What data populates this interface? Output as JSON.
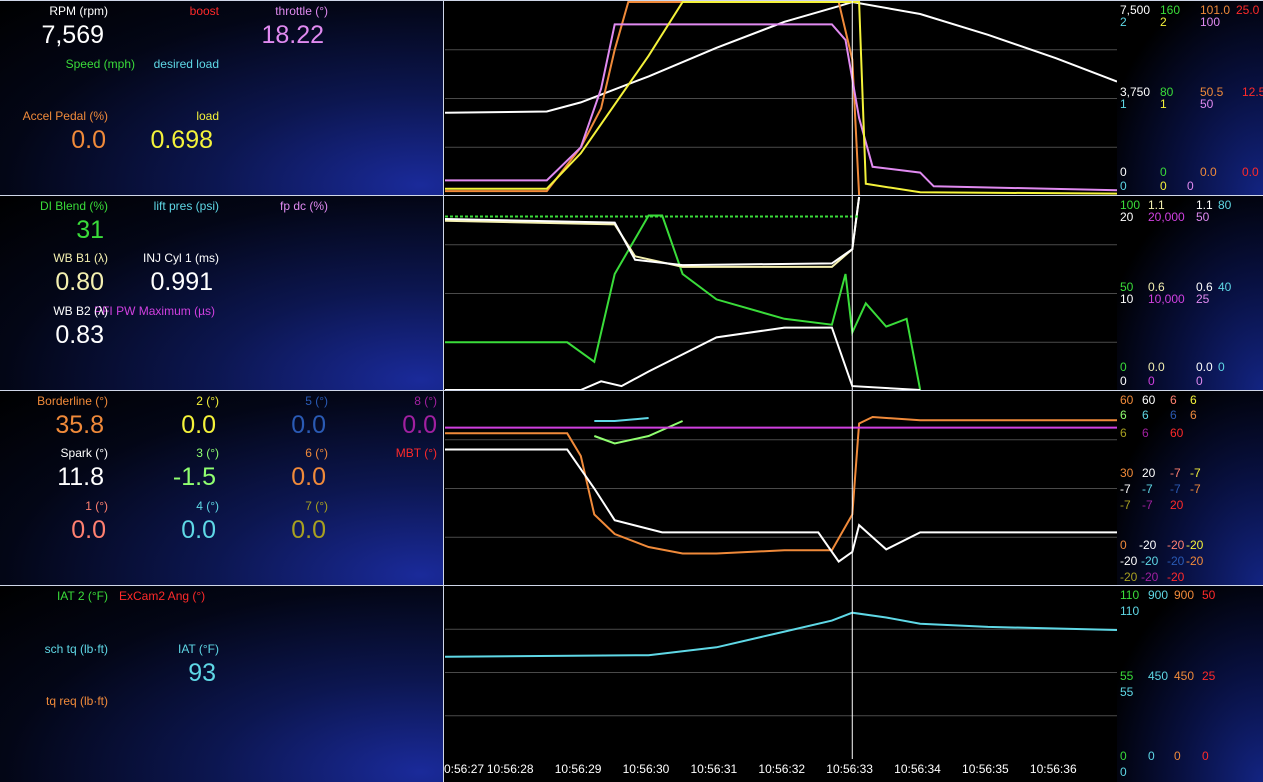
{
  "colors": {
    "white": "#ffffff",
    "orange": "#f08a3a",
    "yellow": "#f4f23a",
    "violet": "#e08af0",
    "green": "#3adc3a",
    "cyan": "#5fd8e6",
    "red": "#ff2a2a",
    "lightyellow": "#f4f0b0",
    "magenta": "#d040e0",
    "blue": "#2a5ab4",
    "purple": "#a020a0",
    "olive": "#a8a020",
    "salmon": "#ff8070",
    "lightgreen": "#90ff70"
  },
  "panels": [
    {
      "gauges": [
        {
          "label": "RPM (rpm)",
          "value": "7,569"
        },
        {
          "label": "boost",
          "value": ""
        },
        {
          "label": "throttle (°)",
          "value": "18.22"
        },
        {
          "label": "Speed (mph)",
          "value": ""
        },
        {
          "label": "desired load",
          "value": ""
        },
        {
          "label": "Accel Pedal (%)",
          "value": "0.0"
        },
        {
          "label": "load",
          "value": "0.698"
        }
      ],
      "scale": {
        "top": [
          "7,500",
          "160",
          "101.0",
          "25.0"
        ],
        "top2": [
          "2",
          "2",
          "100"
        ],
        "mid": [
          "3,750",
          "80",
          "50.5",
          "12.5"
        ],
        "mid2": [
          "1",
          "1",
          "50"
        ],
        "bot": [
          "0",
          "0",
          "0.0",
          "0.0"
        ],
        "bot2": [
          "0",
          "0",
          "0"
        ]
      }
    },
    {
      "gauges": [
        {
          "label": "DI Blend (%)",
          "value": "31"
        },
        {
          "label": "lift pres (psi)",
          "value": ""
        },
        {
          "label": "fp dc (%)",
          "value": ""
        },
        {
          "label": "WB B1 (λ)",
          "value": "0.80"
        },
        {
          "label": "INJ Cyl 1 (ms)",
          "value": "0.991"
        },
        {
          "label": "WB B2 (λ)",
          "value": "0.83"
        },
        {
          "label": "PFI PW Maximum (µs)",
          "value": ""
        }
      ],
      "scale": {
        "top": [
          "100",
          "1.1",
          "1.1",
          "80"
        ],
        "top2": [
          "20",
          "20,000",
          "50"
        ],
        "mid": [
          "50",
          "0.6",
          "0.6",
          "40"
        ],
        "mid2": [
          "10",
          "10,000",
          "25"
        ],
        "bot": [
          "0",
          "0.0",
          "0.0",
          "0"
        ],
        "bot2": [
          "0",
          "0",
          "0"
        ]
      }
    },
    {
      "gauges": [
        {
          "label": "Borderline (°)",
          "value": "35.8"
        },
        {
          "label": "2 (°)",
          "value": "0.0"
        },
        {
          "label": "5 (°)",
          "value": "0.0"
        },
        {
          "label": "8 (°)",
          "value": "0.0"
        },
        {
          "label": "Spark (°)",
          "value": "11.8"
        },
        {
          "label": "3 (°)",
          "value": "-1.5"
        },
        {
          "label": "6 (°)",
          "value": "0.0"
        },
        {
          "label": "MBT (°)",
          "value": ""
        },
        {
          "label": "1 (°)",
          "value": "0.0"
        },
        {
          "label": "4 (°)",
          "value": "0.0"
        },
        {
          "label": "7 (°)",
          "value": "0.0"
        }
      ],
      "scale": {
        "top": [
          "60",
          "60",
          "6",
          "6"
        ],
        "top2": [
          "6",
          "6",
          "6",
          "6"
        ],
        "top3": [
          "6",
          "6",
          "60"
        ],
        "mid": [
          "30",
          "20",
          "-7",
          "-7"
        ],
        "mid2": [
          "-7",
          "-7",
          "-7",
          "-7"
        ],
        "mid3": [
          "-7",
          "-7",
          "20"
        ],
        "bot": [
          "0",
          "-20",
          "-20",
          "-20"
        ],
        "bot2": [
          "-20",
          "-20",
          "-20",
          "-20"
        ],
        "bot3": [
          "-20",
          "-20",
          "-20"
        ]
      }
    },
    {
      "gauges": [
        {
          "label": "IAT 2 (°F)",
          "value": ""
        },
        {
          "label": "ExCam2 Ang (°)",
          "value": ""
        },
        {
          "label": "sch tq (lb·ft)",
          "value": ""
        },
        {
          "label": "IAT (°F)",
          "value": "93"
        },
        {
          "label": "tq req (lb·ft)",
          "value": ""
        }
      ],
      "scale": {
        "top": [
          "110",
          "900",
          "900",
          "50"
        ],
        "top2": [
          "110"
        ],
        "mid": [
          "55",
          "450",
          "450",
          "25"
        ],
        "mid2": [
          "55"
        ],
        "bot": [
          "0",
          "0",
          "0",
          "0"
        ],
        "bot2": [
          "0"
        ]
      }
    }
  ],
  "chart_data": [
    {
      "type": "line",
      "x": [
        "10:56:27",
        "10:56:28",
        "10:56:29",
        "10:56:30",
        "10:56:31",
        "10:56:32",
        "10:56:33",
        "10:56:34",
        "10:56:35",
        "10:56:36"
      ],
      "xlim": [
        "10:56:27",
        "10:56:36.9"
      ],
      "series": [
        {
          "name": "RPM (rpm)",
          "color": "white",
          "ylim": [
            0,
            7500
          ],
          "points": [
            [
              "10:56:27",
              3200
            ],
            [
              "10:56:28.5",
              3250
            ],
            [
              "10:56:29",
              3600
            ],
            [
              "10:56:30",
              4600
            ],
            [
              "10:56:31",
              5700
            ],
            [
              "10:56:32",
              6700
            ],
            [
              "10:56:32.8",
              7300
            ],
            [
              "10:56:33",
              7500
            ],
            [
              "10:56:34",
              7000
            ],
            [
              "10:56:35",
              6200
            ],
            [
              "10:56:36",
              5300
            ],
            [
              "10:56:36.9",
              4400
            ]
          ]
        },
        {
          "name": "boost",
          "color": "orange",
          "ylim": [
            0,
            2
          ],
          "points": [
            [
              "10:56:27",
              0.05
            ],
            [
              "10:56:28.5",
              0.05
            ],
            [
              "10:56:29",
              0.5
            ],
            [
              "10:56:29.3",
              0.9
            ],
            [
              "10:56:29.5",
              1.5
            ],
            [
              "10:56:29.7",
              2.0
            ],
            [
              "10:56:32.8",
              2.0
            ],
            [
              "10:56:33",
              1.4
            ],
            [
              "10:56:33.1",
              0.0
            ]
          ]
        },
        {
          "name": "throttle (°)",
          "color": "violet",
          "ylim": [
            0,
            100
          ],
          "points": [
            [
              "10:56:27",
              8
            ],
            [
              "10:56:28.5",
              8
            ],
            [
              "10:56:29",
              25
            ],
            [
              "10:56:29.3",
              55
            ],
            [
              "10:56:29.5",
              88
            ],
            [
              "10:56:32.7",
              88
            ],
            [
              "10:56:32.9",
              80
            ],
            [
              "10:56:33.1",
              40
            ],
            [
              "10:56:33.3",
              15
            ],
            [
              "10:56:34",
              12
            ],
            [
              "10:56:34.2",
              5
            ],
            [
              "10:56:36.9",
              3
            ]
          ]
        },
        {
          "name": "Speed (mph)",
          "color": "yellow",
          "ylim": [
            0,
            160
          ],
          "points": [
            [
              "10:56:27",
              6
            ],
            [
              "10:56:28.5",
              6
            ],
            [
              "10:56:29",
              35
            ],
            [
              "10:56:30",
              115
            ],
            [
              "10:56:30.5",
              160
            ],
            [
              "10:56:33.1",
              160
            ],
            [
              "10:56:33.2",
              10
            ],
            [
              "10:56:34",
              3
            ],
            [
              "10:56:36.9",
              2
            ]
          ]
        }
      ]
    },
    {
      "type": "line",
      "x": [
        "10:56:27",
        "10:56:28",
        "10:56:29",
        "10:56:30",
        "10:56:31",
        "10:56:32",
        "10:56:33",
        "10:56:34",
        "10:56:35",
        "10:56:36"
      ],
      "xlim": [
        "10:56:27",
        "10:56:36.9"
      ],
      "series": [
        {
          "name": "DI Blend (%)",
          "color": "green",
          "ylim": [
            0,
            100
          ],
          "points": [
            [
              "10:56:27",
              25
            ],
            [
              "10:56:28.8",
              25
            ],
            [
              "10:56:29.2",
              15
            ],
            [
              "10:56:29.5",
              60
            ],
            [
              "10:56:30",
              90
            ],
            [
              "10:56:30.2",
              90
            ],
            [
              "10:56:30.5",
              60
            ],
            [
              "10:56:31",
              47
            ],
            [
              "10:56:32",
              37
            ],
            [
              "10:56:32.7",
              34
            ],
            [
              "10:56:32.9",
              60
            ],
            [
              "10:56:33",
              30
            ],
            [
              "10:56:33.2",
              45
            ],
            [
              "10:56:33.5",
              33
            ],
            [
              "10:56:33.8",
              37
            ],
            [
              "10:56:34",
              0
            ]
          ]
        },
        {
          "name": "WB B1 (λ)",
          "color": "lightyellow",
          "ylim": [
            0,
            1.1
          ],
          "points": [
            [
              "10:56:27",
              0.96
            ],
            [
              "10:56:29.5",
              0.94
            ],
            [
              "10:56:29.8",
              0.76
            ],
            [
              "10:56:30.5",
              0.7
            ],
            [
              "10:56:32.7",
              0.7
            ],
            [
              "10:56:33",
              0.8
            ],
            [
              "10:56:33.1",
              1.1
            ]
          ]
        },
        {
          "name": "WB B2 (λ)",
          "color": "white",
          "ylim": [
            0,
            1.1
          ],
          "points": [
            [
              "10:56:27",
              0.97
            ],
            [
              "10:56:29.5",
              0.95
            ],
            [
              "10:56:29.8",
              0.74
            ],
            [
              "10:56:30.5",
              0.71
            ],
            [
              "10:56:32.7",
              0.72
            ],
            [
              "10:56:33",
              0.8
            ],
            [
              "10:56:33.1",
              1.1
            ]
          ]
        },
        {
          "name": "INJ Cyl 1 (ms)",
          "color": "white",
          "ylim": [
            0,
            20
          ],
          "points": [
            [
              "10:56:27",
              0
            ],
            [
              "10:56:29",
              0
            ],
            [
              "10:56:29.3",
              1
            ],
            [
              "10:56:29.6",
              0.5
            ],
            [
              "10:56:30",
              2
            ],
            [
              "10:56:31",
              5.5
            ],
            [
              "10:56:32",
              6.5
            ],
            [
              "10:56:32.7",
              6.5
            ],
            [
              "10:56:33",
              0.5
            ],
            [
              "10:56:34",
              0
            ]
          ]
        },
        {
          "name": "lift pres (psi)",
          "color": "green",
          "ylim": [
            0,
            20
          ],
          "points": [
            [
              "10:56:27",
              17.9
            ],
            [
              "10:56:33.1",
              17.9
            ]
          ]
        }
      ]
    },
    {
      "type": "line",
      "x": [
        "10:56:27",
        "10:56:28",
        "10:56:29",
        "10:56:30",
        "10:56:31",
        "10:56:32",
        "10:56:33",
        "10:56:34",
        "10:56:35",
        "10:56:36"
      ],
      "xlim": [
        "10:56:27",
        "10:56:36.9"
      ],
      "series": [
        {
          "name": "Borderline (°)",
          "color": "orange",
          "ylim": [
            0,
            60
          ],
          "points": [
            [
              "10:56:27",
              47
            ],
            [
              "10:56:28.8",
              47
            ],
            [
              "10:56:29",
              40
            ],
            [
              "10:56:29.2",
              22
            ],
            [
              "10:56:29.5",
              16
            ],
            [
              "10:56:30",
              12
            ],
            [
              "10:56:30.5",
              10
            ],
            [
              "10:56:31",
              10
            ],
            [
              "10:56:32",
              11
            ],
            [
              "10:56:32.7",
              11
            ],
            [
              "10:56:33",
              22
            ],
            [
              "10:56:33.1",
              50
            ],
            [
              "10:56:33.3",
              52
            ],
            [
              "10:56:34",
              51
            ],
            [
              "10:56:36.9",
              51
            ]
          ]
        },
        {
          "name": "Spark (°)",
          "color": "white",
          "ylim": [
            -20,
            60
          ],
          "points": [
            [
              "10:56:27",
              36
            ],
            [
              "10:56:28.8",
              36
            ],
            [
              "10:56:29.2",
              20
            ],
            [
              "10:56:29.5",
              7
            ],
            [
              "10:56:30.2",
              2
            ],
            [
              "10:56:32.5",
              2
            ],
            [
              "10:56:32.8",
              -10
            ],
            [
              "10:56:33",
              -6
            ],
            [
              "10:56:33.1",
              5
            ],
            [
              "10:56:33.3",
              0
            ],
            [
              "10:56:33.5",
              -5
            ],
            [
              "10:56:34",
              2
            ],
            [
              "10:56:36.9",
              2
            ]
          ]
        },
        {
          "name": "3 (°)",
          "color": "lightgreen",
          "ylim": [
            -7,
            6
          ],
          "points": [
            [
              "10:56:29.2",
              3
            ],
            [
              "10:56:29.5",
              2.5
            ],
            [
              "10:56:30",
              3
            ],
            [
              "10:56:30.5",
              4
            ]
          ]
        },
        {
          "name": "2 (°)",
          "color": "cyan",
          "ylim": [
            -7,
            6
          ],
          "points": [
            [
              "10:56:29.2",
              4
            ],
            [
              "10:56:29.5",
              4
            ],
            [
              "10:56:30",
              4.2
            ]
          ]
        },
        {
          "name": "MBT (°)",
          "color": "magenta",
          "ylim": [
            -20,
            60
          ],
          "points": [
            [
              "10:56:27",
              45
            ],
            [
              "10:56:36.9",
              45
            ]
          ]
        }
      ]
    },
    {
      "type": "line",
      "x": [
        "10:56:27",
        "10:56:28",
        "10:56:29",
        "10:56:30",
        "10:56:31",
        "10:56:32",
        "10:56:33",
        "10:56:34",
        "10:56:35",
        "10:56:36"
      ],
      "xlim": [
        "10:56:27",
        "10:56:36.9"
      ],
      "series": [
        {
          "name": "IAT (°F)",
          "color": "cyan",
          "ylim": [
            0,
            110
          ],
          "points": [
            [
              "10:56:27",
              65
            ],
            [
              "10:56:30",
              66
            ],
            [
              "10:56:31",
              71
            ],
            [
              "10:56:32",
              81
            ],
            [
              "10:56:32.7",
              88
            ],
            [
              "10:56:33",
              93
            ],
            [
              "10:56:33.5",
              90
            ],
            [
              "10:56:34",
              86
            ],
            [
              "10:56:35",
              84
            ],
            [
              "10:56:36",
              83
            ],
            [
              "10:56:36.9",
              82
            ]
          ]
        }
      ]
    }
  ]
}
